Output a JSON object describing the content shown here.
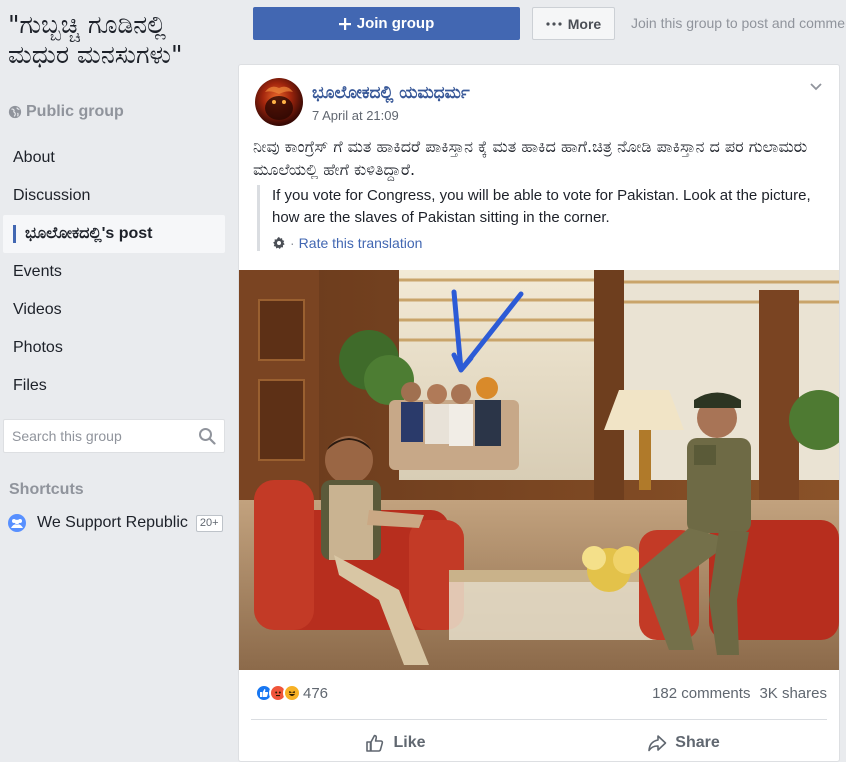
{
  "group": {
    "title": "\"ಗುಬ್ಬಚ್ಚಿ ಗೂಡಿನಲ್ಲಿ ಮಧುರ ಮನಸುಗಳು\"",
    "privacy": "Public group"
  },
  "sidebar": {
    "items": [
      {
        "label": "About"
      },
      {
        "label": "Discussion"
      },
      {
        "label": "ಭೂಲೋಕದಲ್ಲಿ's post"
      },
      {
        "label": "Events"
      },
      {
        "label": "Videos"
      },
      {
        "label": "Photos"
      },
      {
        "label": "Files"
      }
    ],
    "active_index": 2,
    "search_placeholder": "Search this group",
    "shortcuts_heading": "Shortcuts",
    "shortcut": {
      "label": "We Support Republic",
      "badge": "20+"
    }
  },
  "topbar": {
    "join_label": "Join group",
    "more_label": "More",
    "hint": "Join this group to post and comment."
  },
  "post": {
    "author": "ಭೂಲೋಕದಲ್ಲಿ ಯಮಧರ್ಮ",
    "time": "7 April at 21:09",
    "text": "ನೀವು ಕಾಂಗ್ರೆಸ್ ಗೆ ಮತ ಹಾಕಿದರೆ ಪಾಕಿಸ್ತಾನ ಕ್ಕೆ ಮತ ಹಾಕಿದ ಹಾಗೆ.ಚಿತ್ರ ನೋಡಿ ಪಾಕಿಸ್ತಾನ ದ ಪರ ಗುಲಾಮರು ಮೂಲೆಯಲ್ಲಿ ಹೇಗೆ ಕುಳಿತಿದ್ದಾರೆ.",
    "translation": "If you vote for Congress, you will be able to vote for Pakistan. Look at the picture, how are the slaves of Pakistan sitting in the corner.",
    "rate_translation": "Rate this translation",
    "reaction_count": "476",
    "comments": "182 comments",
    "shares": "3K shares",
    "like_label": "Like",
    "share_label": "Share"
  },
  "colors": {
    "brand": "#4267b2",
    "link": "#385898",
    "background": "#e9ebee",
    "like_reaction": "#1877f2",
    "angry_reaction": "#f0553a",
    "haha_reaction": "#f7b125"
  },
  "icons": {
    "privacy": "globe-icon",
    "search": "search-icon",
    "shortcut": "group-icon",
    "join": "plus-icon",
    "more": "ellipsis-icon",
    "post_menu": "chevron-down-icon",
    "translation": "gear-icon",
    "like": "thumbs-up-icon",
    "share": "share-arrow-icon"
  }
}
